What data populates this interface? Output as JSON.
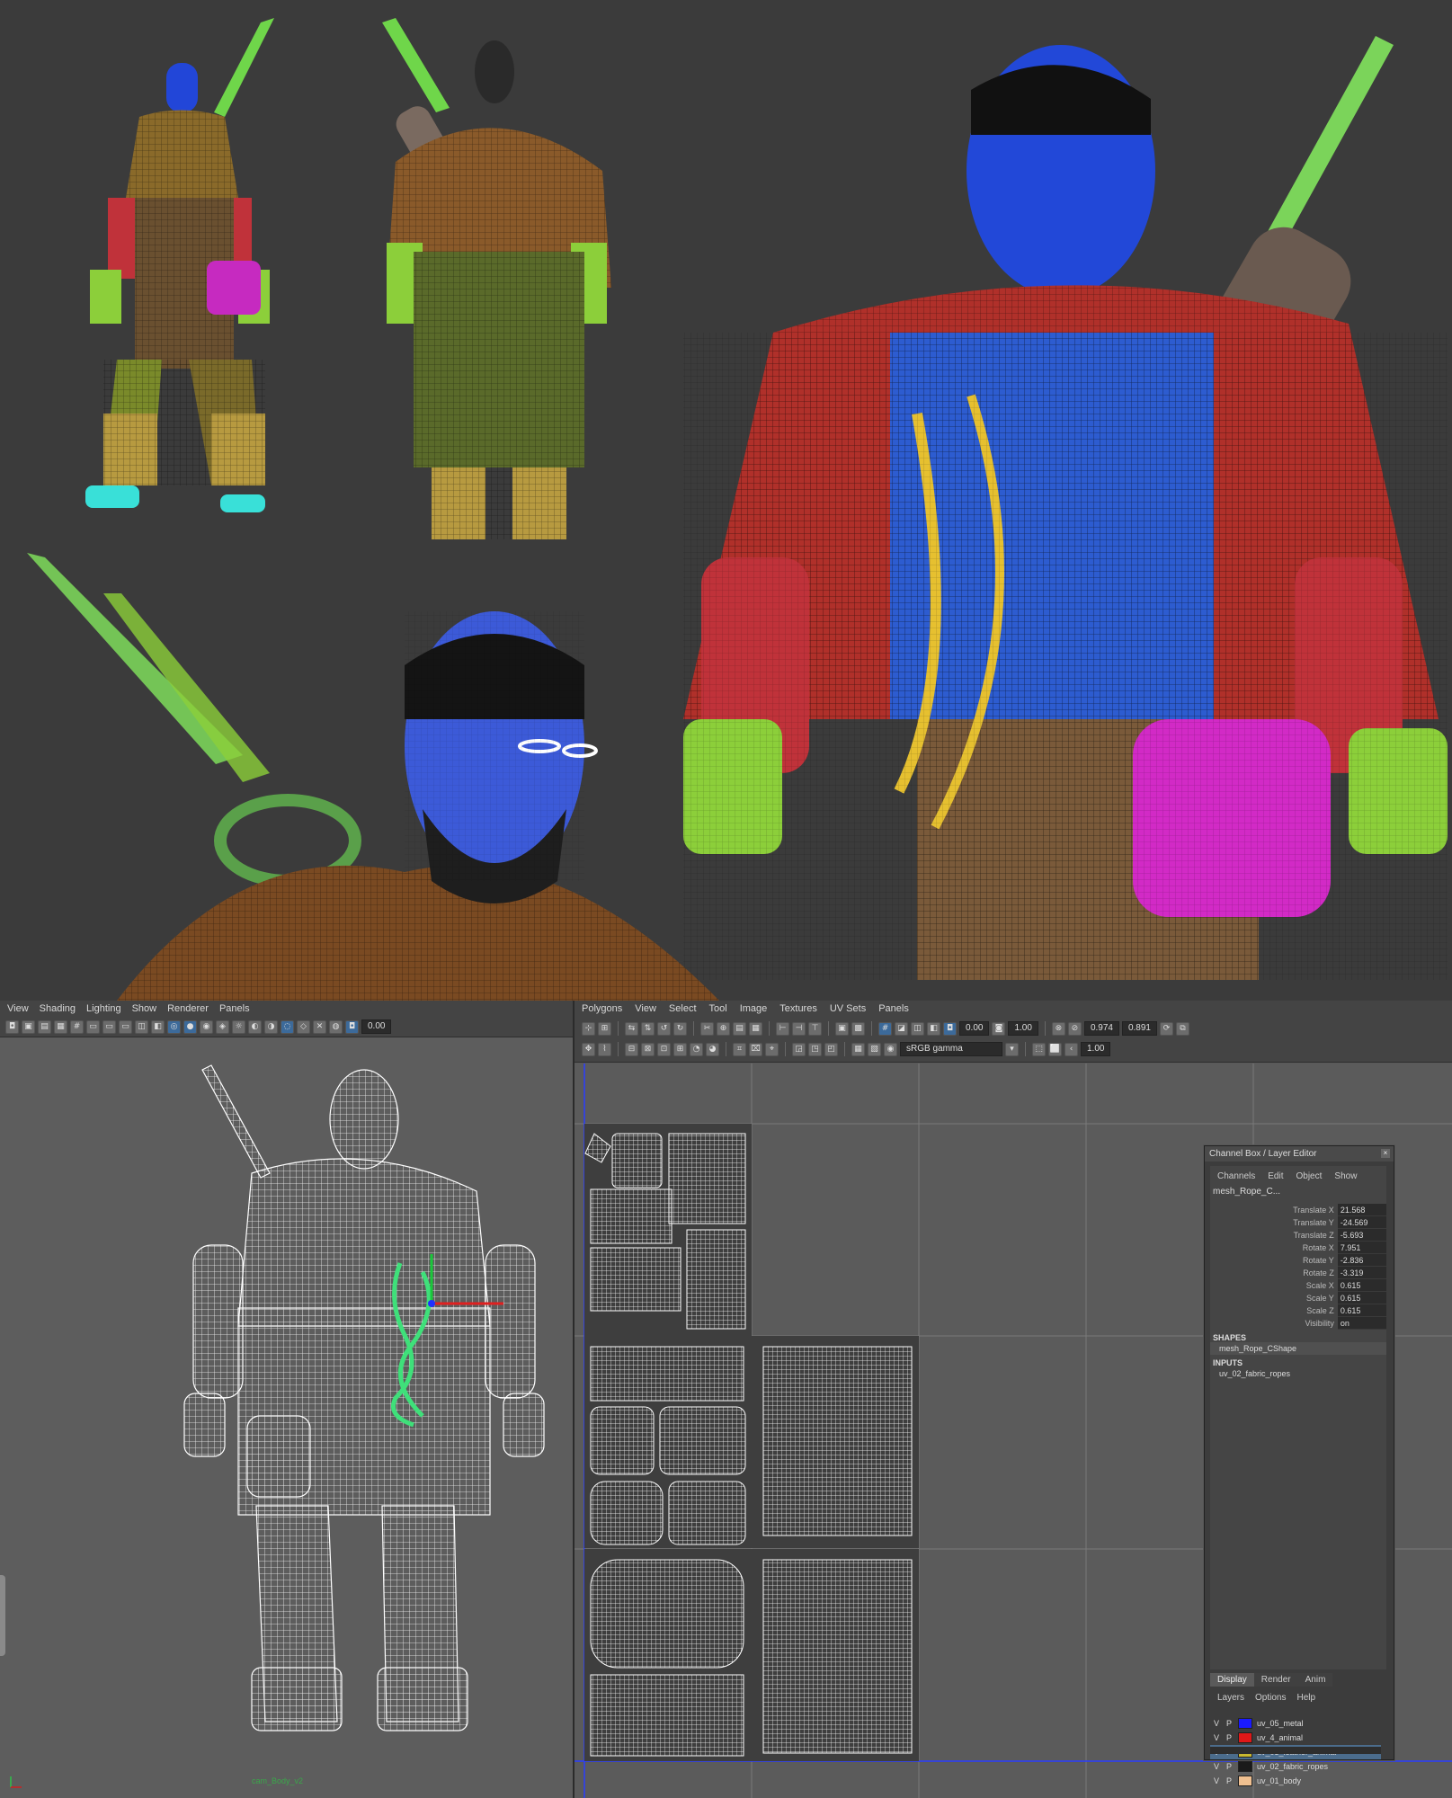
{
  "viewport_left": {
    "menu": [
      "View",
      "Shading",
      "Lighting",
      "Show",
      "Renderer",
      "Panels"
    ],
    "toolbar_value": "0.00",
    "camera_name": "cam_Body_v2"
  },
  "uv_editor": {
    "menu": [
      "Polygons",
      "View",
      "Select",
      "Tool",
      "Image",
      "Textures",
      "UV Sets",
      "Panels"
    ],
    "field_1": "0.00",
    "field_2": "1.00",
    "field_3": "0.974",
    "field_4": "0.891",
    "zoom": "1.00",
    "colorspace": "sRGB gamma"
  },
  "channel_box": {
    "title": "Channel Box / Layer Editor",
    "menu": [
      "Channels",
      "Edit",
      "Object",
      "Show"
    ],
    "node": "mesh_Rope_C...",
    "attributes": [
      {
        "label": "Translate X",
        "value": "21.568"
      },
      {
        "label": "Translate Y",
        "value": "-24.569"
      },
      {
        "label": "Translate Z",
        "value": "-5.693"
      },
      {
        "label": "Rotate X",
        "value": "7.951"
      },
      {
        "label": "Rotate Y",
        "value": "-2.836"
      },
      {
        "label": "Rotate Z",
        "value": "-3.319"
      },
      {
        "label": "Scale X",
        "value": "0.615"
      },
      {
        "label": "Scale Y",
        "value": "0.615"
      },
      {
        "label": "Scale Z",
        "value": "0.615"
      },
      {
        "label": "Visibility",
        "value": "on"
      }
    ],
    "shapes_label": "SHAPES",
    "shape": "mesh_Rope_CShape",
    "inputs_label": "INPUTS",
    "input": "uv_02_fabric_ropes",
    "tabs": [
      "Display",
      "Render",
      "Anim"
    ],
    "layer_menu": [
      "Layers",
      "Options",
      "Help"
    ],
    "layers": [
      {
        "name": "uv_05_metal",
        "color": "#1a1aff"
      },
      {
        "name": "uv_4_animal",
        "color": "#e01818"
      },
      {
        "name": "uv_03_leather_animal",
        "color": "#c8b830"
      },
      {
        "name": "uv_02_fabric_ropes",
        "color": "#1a1a1a"
      },
      {
        "name": "uv_01_body",
        "color": "#f0c090"
      }
    ],
    "layer_v": "V",
    "layer_p": "P"
  }
}
